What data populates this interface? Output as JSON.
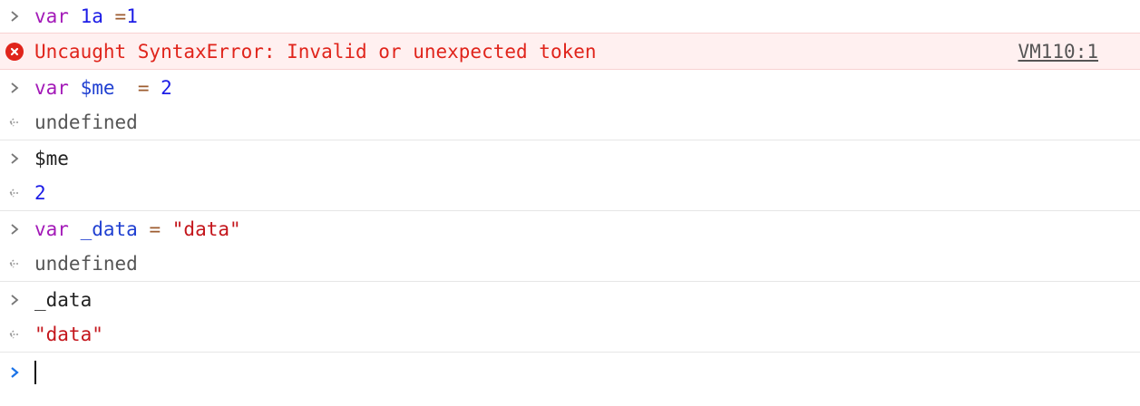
{
  "console": {
    "entry1": {
      "kw": "var",
      "ident": "1a",
      "op": "=",
      "num": "1"
    },
    "error": {
      "message": "Uncaught SyntaxError: Invalid or unexpected token",
      "source": "VM110:1"
    },
    "entry2": {
      "kw": "var",
      "ident": "$me",
      "op": "=",
      "num": "2"
    },
    "result2": "undefined",
    "entry3": {
      "ident": "$me"
    },
    "result3": "2",
    "entry4": {
      "kw": "var",
      "ident": "_data",
      "op": "=",
      "str": "\"data\""
    },
    "result4": "undefined",
    "entry5": {
      "ident": "_data"
    },
    "result5": "\"data\"",
    "icons": {
      "input": "chevron-right-icon",
      "output": "return-arrow-icon",
      "error": "error-x-icon",
      "prompt": "prompt-chevron-icon"
    },
    "colors": {
      "error_text": "#e0241b",
      "error_bg": "#fff0f0",
      "prompt_accent": "#1a73e8",
      "keyword": "#a31ab8",
      "number": "#1c1ce6",
      "string": "#c4161c"
    }
  }
}
